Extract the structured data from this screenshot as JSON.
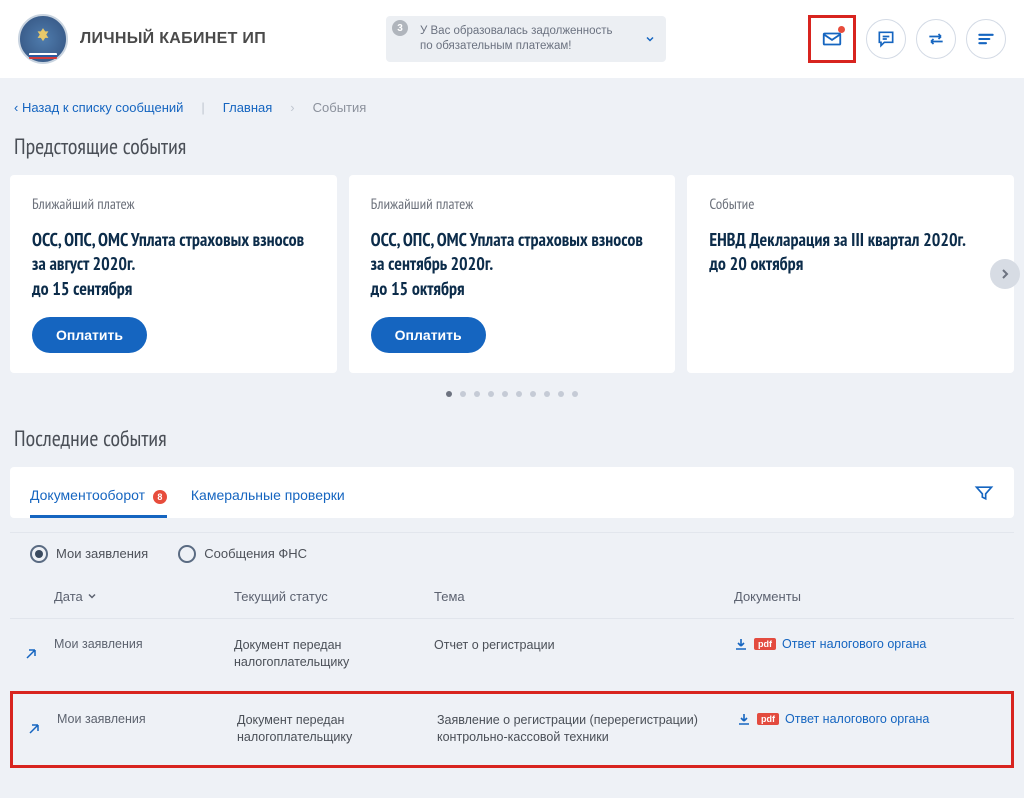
{
  "header": {
    "title": "ЛИЧНЫЙ КАБИНЕТ ИП",
    "notification_badge": "3",
    "notification_text": "У Вас образовалась задолженность по обязательным платежам!"
  },
  "breadcrumb": {
    "back": "Назад к списку сообщений",
    "home": "Главная",
    "current": "События"
  },
  "upcoming": {
    "heading": "Предстоящие события",
    "cards": [
      {
        "eyebrow": "Ближайший платеж",
        "title": "ОСС, ОПС, ОМС Уплата страховых взносов за август 2020г.\nдо 15 сентября",
        "action": "Оплатить"
      },
      {
        "eyebrow": "Ближайший платеж",
        "title": "ОСС, ОПС, ОМС Уплата страховых взносов за сентябрь 2020г.\nдо 15 октября",
        "action": "Оплатить"
      },
      {
        "eyebrow": "Событие",
        "title": "ЕНВД Декларация за III квартал 2020г.\nдо 20 октября",
        "action": ""
      }
    ]
  },
  "recent": {
    "heading": "Последние события",
    "tabs": [
      {
        "label": "Документооборот",
        "badge": "8",
        "active": true
      },
      {
        "label": "Камеральные проверки",
        "badge": "",
        "active": false
      }
    ],
    "radios": [
      {
        "label": "Мои заявления",
        "checked": true
      },
      {
        "label": "Сообщения ФНС",
        "checked": false
      }
    ],
    "columns": {
      "date": "Дата",
      "status": "Текущий статус",
      "subject": "Тема",
      "docs": "Документы"
    },
    "rows": [
      {
        "category": "Мои заявления",
        "status": "Документ передан налогоплательщику",
        "subject": "Отчет о регистрации",
        "doc_label": "Ответ налогового органа"
      },
      {
        "category": "Мои заявления",
        "status": "Документ передан налогоплательщику",
        "subject": "Заявление о регистрации (перерегистрации) контрольно-кассовой техники",
        "doc_label": "Ответ налогового органа"
      }
    ]
  }
}
